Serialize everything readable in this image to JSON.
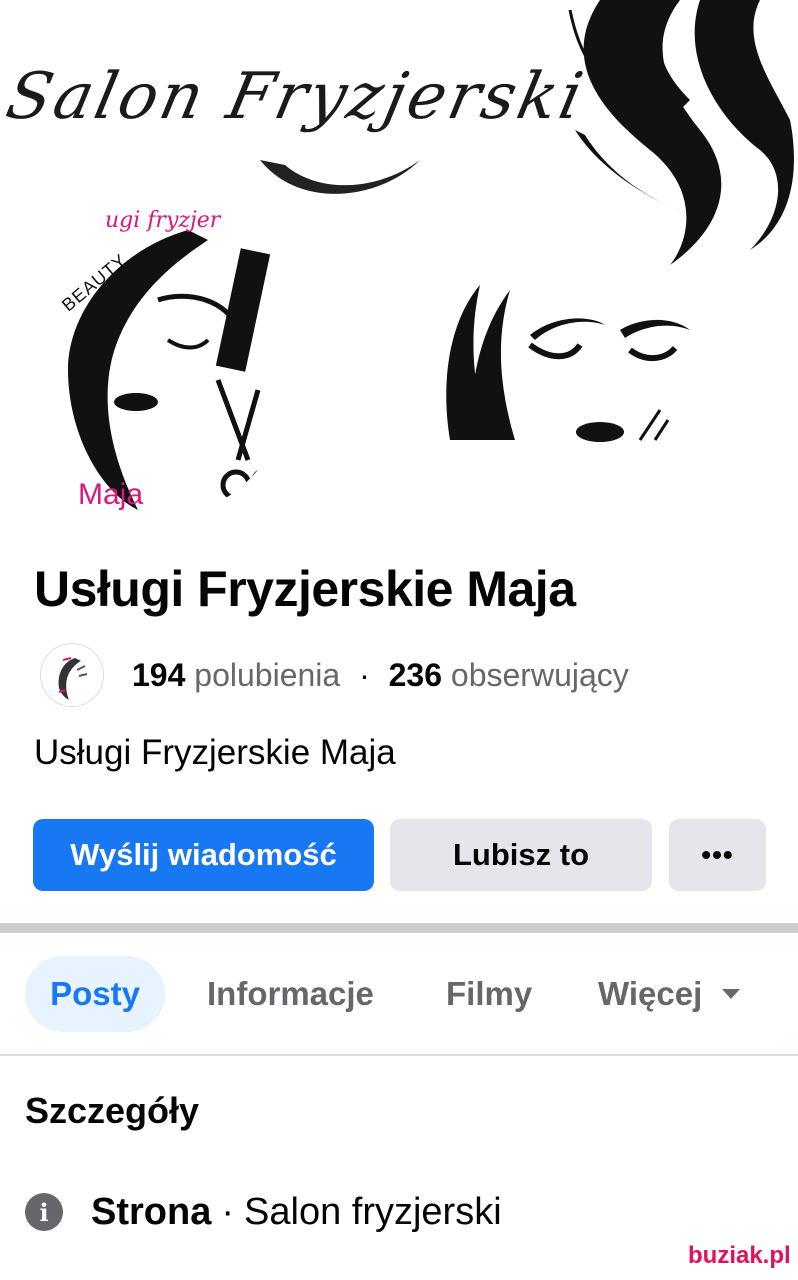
{
  "cover": {
    "title": "Salon Fryzjerski",
    "logo_top_text": "ugi fryzjer",
    "logo_badge": "BEAUTY",
    "logo_name": "Maja"
  },
  "page": {
    "name": "Usługi Fryzjerskie Maja",
    "likes_count": "194",
    "likes_label": "polubienia",
    "separator": "·",
    "followers_count": "236",
    "followers_label": "obserwujący",
    "description": "Usługi Fryzjerskie Maja"
  },
  "actions": {
    "message_label": "Wyślij wiadomość",
    "like_label": "Lubisz to",
    "more_label": "•••"
  },
  "tabs": [
    {
      "label": "Posty",
      "active": true
    },
    {
      "label": "Informacje",
      "active": false
    },
    {
      "label": "Filmy",
      "active": false
    },
    {
      "label": "Więcej",
      "active": false
    }
  ],
  "details": {
    "title": "Szczegóły",
    "category_key": "Strona",
    "category_sep": "·",
    "category_value": "Salon fryzjerski"
  },
  "watermark": "buziak.pl",
  "colors": {
    "accent": "#1877f2",
    "accent_bg": "#e7f3ff",
    "secondary_button": "#e4e6eb",
    "muted_text": "#65676b",
    "logo_pink": "#d8177f"
  },
  "icons": [
    "info-icon",
    "dropdown-caret-icon",
    "more-dots-icon"
  ]
}
